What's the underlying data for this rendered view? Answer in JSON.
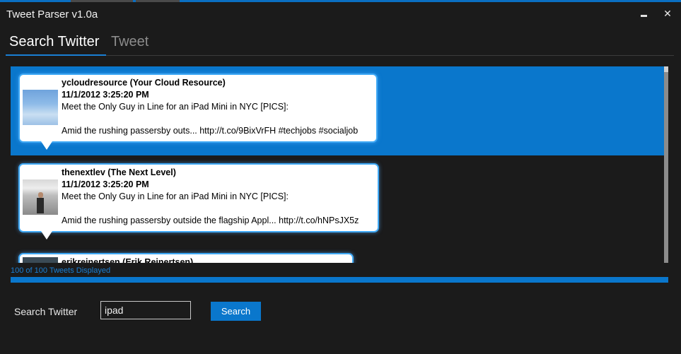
{
  "window": {
    "title": "Tweet Parser v1.0a",
    "minimize_icon": "minimize-icon",
    "close_glyph": "✕"
  },
  "tabs": [
    {
      "label": "Search Twitter",
      "active": true
    },
    {
      "label": "Tweet",
      "active": false
    }
  ],
  "tweets": [
    {
      "user": "ycloudresource (Your Cloud Resource)",
      "time": "11/1/2012 3:25:20 PM",
      "line1": "Meet the Only Guy in Line for an iPad Mini in NYC [PICS]:",
      "line2": "Amid the rushing passersby outs... http://t.co/9BixVrFH #techjobs #socialjob",
      "selected": true
    },
    {
      "user": "thenextlev (The Next Level)",
      "time": "11/1/2012 3:25:20 PM",
      "line1": "Meet the Only Guy in Line for an iPad Mini in NYC [PICS]:",
      "line2": "Amid the rushing passersby outside the flagship Appl... http://t.co/hNPsJX5z",
      "selected": false
    },
    {
      "user": "erikreinertsen (Erik Reinertsen)",
      "selected": false
    }
  ],
  "status": {
    "text": "100 of 100 Tweets Displayed",
    "progress": 1.0
  },
  "search": {
    "label": "Search Twitter",
    "value": "ipad",
    "button_label": "Search"
  },
  "colors": {
    "accent": "#0a77cc",
    "background": "#1b1b1b",
    "bubble_border": "#3fa9f5"
  }
}
